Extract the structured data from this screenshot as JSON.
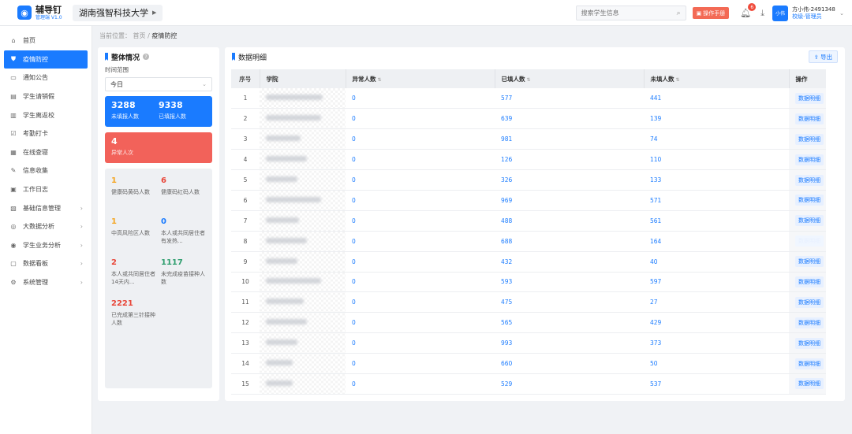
{
  "app": {
    "name": "辅导钉",
    "sub": "管理端 V1.0",
    "school": "湖南强智科技大学"
  },
  "header": {
    "search_placeholder": "搜索学生信息",
    "manual_label": "操作手册",
    "notification_count": "6",
    "avatar_text": "小伟",
    "user_name": "方小伟-2491348",
    "user_role": "校级-管理员"
  },
  "sidebar": {
    "items": [
      {
        "label": "首页",
        "icon": "home-icon",
        "glyph": "⌂",
        "has_children": false
      },
      {
        "label": "疫情防控",
        "icon": "shield-icon",
        "glyph": "⛊",
        "has_children": false,
        "active": true
      },
      {
        "label": "通知公告",
        "icon": "notice-icon",
        "glyph": "▭",
        "has_children": false
      },
      {
        "label": "学生请销假",
        "icon": "leave-icon",
        "glyph": "▤",
        "has_children": false
      },
      {
        "label": "学生离返校",
        "icon": "building-icon",
        "glyph": "▥",
        "has_children": false
      },
      {
        "label": "考勤打卡",
        "icon": "checkin-icon",
        "glyph": "☑",
        "has_children": false
      },
      {
        "label": "在线查寝",
        "icon": "dorm-icon",
        "glyph": "▦",
        "has_children": false
      },
      {
        "label": "信息收集",
        "icon": "edit-icon",
        "glyph": "✎",
        "has_children": false
      },
      {
        "label": "工作日志",
        "icon": "log-icon",
        "glyph": "▣",
        "has_children": false
      },
      {
        "label": "基础信息管理",
        "icon": "info-icon",
        "glyph": "▧",
        "has_children": true
      },
      {
        "label": "大数据分析",
        "icon": "data-icon",
        "glyph": "◎",
        "has_children": true
      },
      {
        "label": "学生业务分析",
        "icon": "analysis-icon",
        "glyph": "◉",
        "has_children": true
      },
      {
        "label": "数据看板",
        "icon": "board-icon",
        "glyph": "▢",
        "has_children": true
      },
      {
        "label": "系统管理",
        "icon": "settings-icon",
        "glyph": "⚙",
        "has_children": true
      }
    ]
  },
  "breadcrumb": {
    "prefix": "当前位置：",
    "home": "首页",
    "sep": "/",
    "current": "疫情防控"
  },
  "overview": {
    "title": "整体情况",
    "time_label": "时间范围",
    "time_value": "今日",
    "unfilled_num": "3288",
    "unfilled_label": "未填报人数",
    "filled_num": "9338",
    "filled_label": "已填报人数",
    "abnormal_num": "4",
    "abnormal_label": "异常人次",
    "health": [
      {
        "num": "1",
        "label": "健康码黄码人数",
        "color": "#f5a623"
      },
      {
        "num": "6",
        "label": "健康码红码人数",
        "color": "#e8473a"
      },
      {
        "num": "1",
        "label": "中高风险区人数",
        "color": "#f5a623"
      },
      {
        "num": "0",
        "label": "本人或共同居住者有发热...",
        "color": "#1a7bff"
      },
      {
        "num": "2",
        "label": "本人或共同居住者14天内...",
        "color": "#e8473a"
      },
      {
        "num": "1117",
        "label": "未完成疫苗接种人数",
        "color": "#2f9e6e"
      },
      {
        "num": "2221",
        "label": "已完成第三针接种人数",
        "color": "#e8473a"
      }
    ]
  },
  "detail": {
    "title": "数据明细",
    "export_label": "导出",
    "columns": {
      "idx": "序号",
      "school": "学院",
      "abnormal": "异常人数",
      "filled": "已填人数",
      "unfilled": "未填人数",
      "op": "操作"
    },
    "op_label": "数据明细",
    "rows": [
      {
        "idx": "1",
        "abnormal": "0",
        "filled": "577",
        "unfilled": "441",
        "w": 72
      },
      {
        "idx": "2",
        "abnormal": "0",
        "filled": "639",
        "unfilled": "139",
        "w": 70
      },
      {
        "idx": "3",
        "abnormal": "0",
        "filled": "981",
        "unfilled": "74",
        "w": 44
      },
      {
        "idx": "4",
        "abnormal": "0",
        "filled": "126",
        "unfilled": "110",
        "w": 52
      },
      {
        "idx": "5",
        "abnormal": "0",
        "filled": "326",
        "unfilled": "133",
        "w": 40
      },
      {
        "idx": "6",
        "abnormal": "0",
        "filled": "969",
        "unfilled": "571",
        "w": 70
      },
      {
        "idx": "7",
        "abnormal": "0",
        "filled": "488",
        "unfilled": "561",
        "w": 42
      },
      {
        "idx": "8",
        "abnormal": "0",
        "filled": "688",
        "unfilled": "164",
        "w": 52,
        "faded": true
      },
      {
        "idx": "9",
        "abnormal": "0",
        "filled": "432",
        "unfilled": "40",
        "w": 40
      },
      {
        "idx": "10",
        "abnormal": "0",
        "filled": "593",
        "unfilled": "597",
        "w": 70
      },
      {
        "idx": "11",
        "abnormal": "0",
        "filled": "475",
        "unfilled": "27",
        "w": 48
      },
      {
        "idx": "12",
        "abnormal": "0",
        "filled": "565",
        "unfilled": "429",
        "w": 52
      },
      {
        "idx": "13",
        "abnormal": "0",
        "filled": "993",
        "unfilled": "373",
        "w": 40
      },
      {
        "idx": "14",
        "abnormal": "0",
        "filled": "660",
        "unfilled": "50",
        "w": 34
      },
      {
        "idx": "15",
        "abnormal": "0",
        "filled": "529",
        "unfilled": "537",
        "w": 34
      }
    ]
  }
}
